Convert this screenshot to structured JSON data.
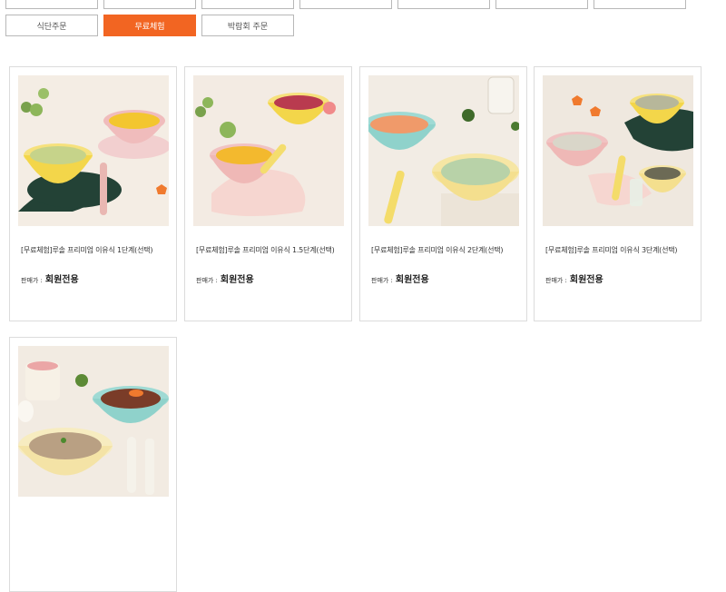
{
  "tabs_row1": [
    {
      "label": ""
    },
    {
      "label": ""
    },
    {
      "label": ""
    },
    {
      "label": ""
    },
    {
      "label": ""
    },
    {
      "label": ""
    },
    {
      "label": ""
    }
  ],
  "tabs_row2": [
    {
      "label": "식단주문",
      "active": false
    },
    {
      "label": "무료체험",
      "active": true
    },
    {
      "label": "박람회 주문",
      "active": false
    }
  ],
  "colors": {
    "accent": "#f26522",
    "border": "#dcdcdc",
    "tab_border": "#b8b8b8"
  },
  "products": [
    {
      "name": "[무료체험]루솔 프리미엄 이유식 1단계(선택)",
      "price_label": "판매가 :",
      "price_value": "회원전용",
      "image": "baby-food-bowls-photo"
    },
    {
      "name": "[무료체험]루솔 프리미엄 이유식 1.5단계(선택)",
      "price_label": "판매가 :",
      "price_value": "회원전용",
      "image": "baby-food-bowls-photo"
    },
    {
      "name": "[무료체험]루솔 프리미엄 이유식 2단계(선택)",
      "price_label": "판매가 :",
      "price_value": "회원전용",
      "image": "baby-food-bowls-photo"
    },
    {
      "name": "[무료체험]루솔 프리미엄 이유식 3단계(선택)",
      "price_label": "판매가 :",
      "price_value": "회원전용",
      "image": "baby-food-bowls-photo"
    },
    {
      "name": "",
      "price_label": "",
      "price_value": "",
      "image": "baby-food-bowls-photo"
    }
  ]
}
